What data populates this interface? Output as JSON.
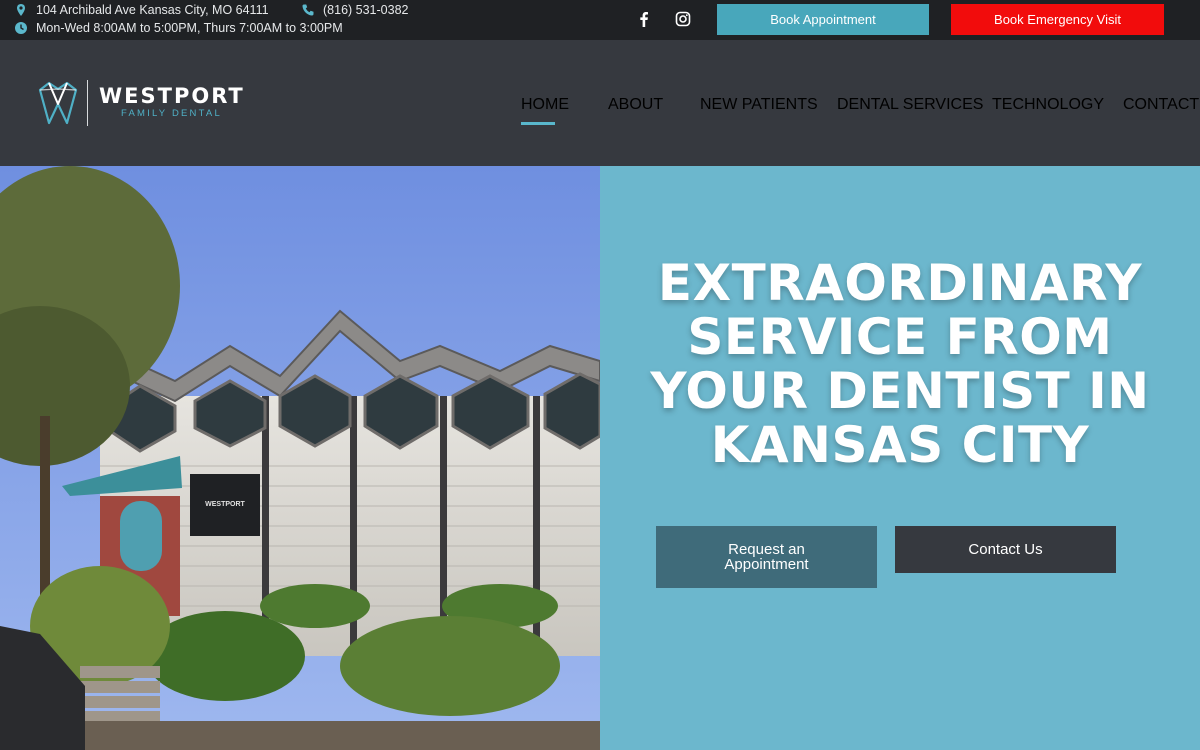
{
  "topbar": {
    "address": "104 Archibald Ave Kansas City, MO 64111",
    "phone": "(816) 531-0382",
    "hours": "Mon-Wed 8:00AM to 5:00PM, Thurs 7:00AM to 3:00PM",
    "book_label": "Book Appointment",
    "emergency_label": "Book Emergency Visit",
    "social_icons": [
      "facebook-icon",
      "instagram-icon"
    ]
  },
  "brand": {
    "name": "WESTPORT",
    "tagline": "FAMILY DENTAL",
    "accent": "#4fb0c6"
  },
  "nav": {
    "items": [
      {
        "label": "HOME",
        "active": true
      },
      {
        "label": "ABOUT"
      },
      {
        "label": "NEW PATIENTS"
      },
      {
        "label": "DENTAL SERVICES"
      },
      {
        "label": "TECHNOLOGY"
      },
      {
        "label": "CONTACT"
      }
    ]
  },
  "hero": {
    "headline_lines": [
      "EXTRAORDINARY",
      "SERVICE FROM",
      "YOUR DENTIST IN",
      "KANSAS CITY"
    ],
    "request_label": "Request an Appointment",
    "contact_label": "Contact Us",
    "panel_color": "#6cb7cd"
  },
  "colors": {
    "topbar_bg": "#1f2124",
    "header_bg": "#36393f",
    "book_button": "#48a7bb",
    "emergency_button": "#f20c0c"
  }
}
